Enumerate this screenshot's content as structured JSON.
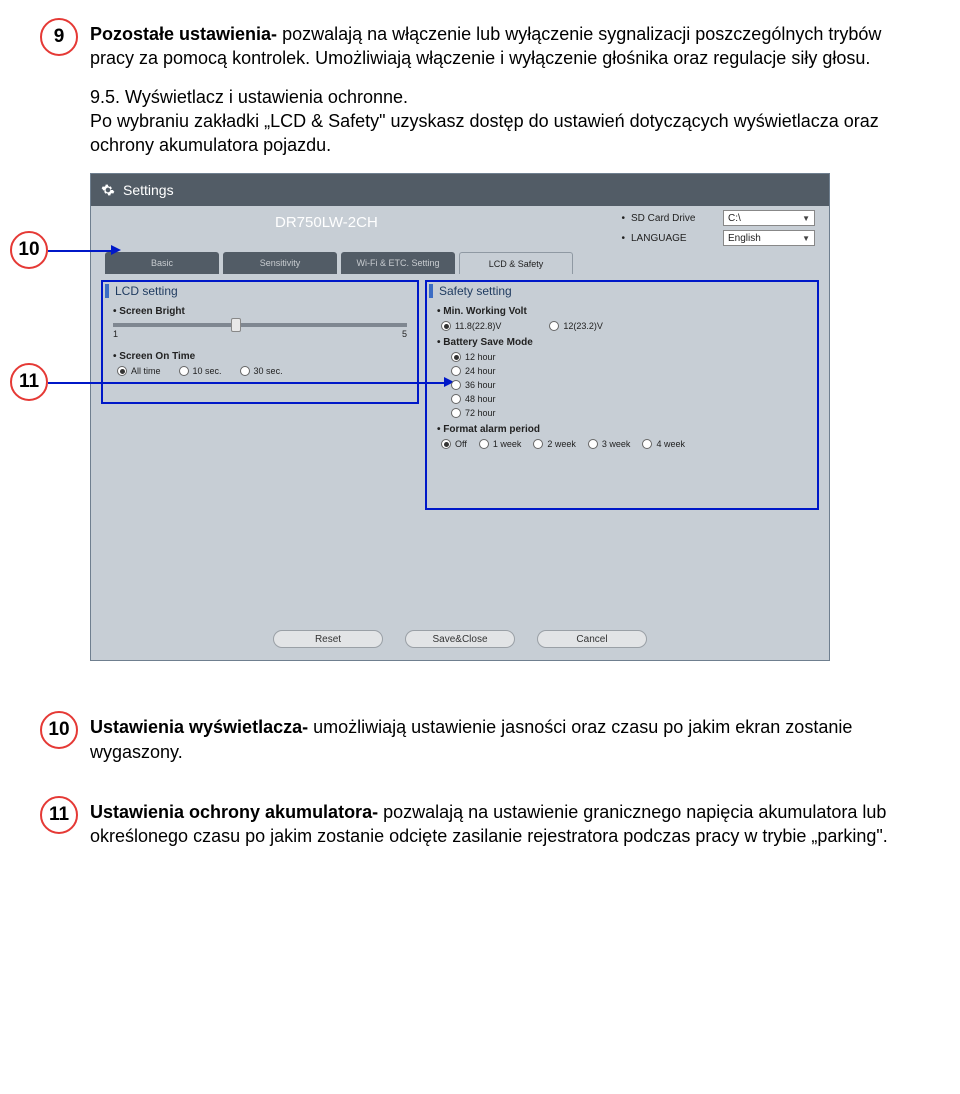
{
  "badges": {
    "b9": "9",
    "b10a": "10",
    "b11a": "11",
    "b10b": "10",
    "b11b": "11"
  },
  "para9": {
    "lead": "Pozostałe ustawienia- ",
    "rest": "pozwalają na włączenie lub wyłączenie sygnalizacji poszczególnych trybów pracy za pomocą kontrolek. Umożliwiają włączenie i wyłączenie głośnika oraz regulacje siły głosu."
  },
  "section95": {
    "num": "9.5. ",
    "title": "Wyświetlacz i ustawienia ochronne.",
    "body": "Po wybraniu zakładki „LCD & Safety\" uzyskasz dostęp do ustawień dotyczących wyświetlacza oraz ochrony akumulatora pojazdu."
  },
  "app": {
    "title": "Settings",
    "model": "DR750LW-2CH",
    "topRight": {
      "sd_label": "SD Card Drive",
      "sd_value": "C:\\",
      "lang_label": "LANGUAGE",
      "lang_value": "English"
    },
    "tabs": {
      "t1": "Basic",
      "t2": "Sensitivity",
      "t3": "Wi-Fi & ETC. Setting",
      "t4": "LCD & Safety"
    },
    "lcd": {
      "head": "LCD setting",
      "bright_label": "Screen Bright",
      "min": "1",
      "max": "5",
      "ontime_label": "Screen On Time",
      "ontime_opts": {
        "o1": "All time",
        "o2": "10 sec.",
        "o3": "30 sec."
      }
    },
    "safety": {
      "head": "Safety setting",
      "volt_label": "Min. Working Volt",
      "volt_opts": {
        "o1": "11.8(22.8)V",
        "o2": "12(23.2)V"
      },
      "save_label": "Battery Save Mode",
      "save_opts": {
        "o1": "12 hour",
        "o2": "24 hour",
        "o3": "36 hour",
        "o4": "48 hour",
        "o5": "72 hour"
      },
      "alarm_label": "Format alarm period",
      "alarm_opts": {
        "o1": "Off",
        "o2": "1 week",
        "o3": "2 week",
        "o4": "3 week",
        "o5": "4 week"
      }
    },
    "buttons": {
      "reset": "Reset",
      "save": "Save&Close",
      "cancel": "Cancel"
    }
  },
  "para10": {
    "lead": "Ustawienia wyświetlacza- ",
    "rest": "umożliwiają ustawienie jasności oraz czasu po jakim ekran zostanie wygaszony."
  },
  "para11": {
    "lead": "Ustawienia ochrony akumulatora- ",
    "rest": "pozwalają na ustawienie granicznego napięcia akumulatora lub określonego czasu po jakim zostanie odcięte zasilanie rejestratora podczas pracy w trybie „parking\"."
  }
}
